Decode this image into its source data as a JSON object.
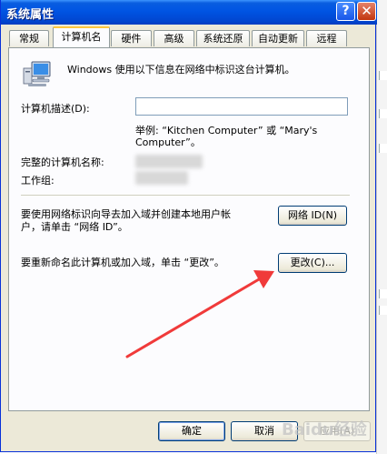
{
  "window": {
    "title": "系统属性"
  },
  "titlebar_buttons": {
    "help": "?",
    "close": "✕"
  },
  "tabs": [
    "常规",
    "计算机名",
    "硬件",
    "高级",
    "系统还原",
    "自动更新",
    "远程"
  ],
  "active_tab": "计算机名",
  "panel": {
    "intro": "Windows 使用以下信息在网络中标识这台计算机。",
    "description_label": "计算机描述(D):",
    "description_value": "",
    "example_line1": "举例: “Kitchen Computer” 或 “Mary's",
    "example_line2": "Computer”。",
    "full_name_label": "完整的计算机名称:",
    "workgroup_label": "工作组:",
    "network_id_text_line1": "要使用网络标识向导去加入域并创建本地用户帐",
    "network_id_text_line2": "户，请单击 “网络 ID”。",
    "network_id_button": "网络 ID(N)",
    "rename_text": "要重新命名此计算机或加入域，单击 “更改”。",
    "change_button": "更改(C)..."
  },
  "footer": {
    "ok": "确定",
    "cancel": "取消",
    "apply": "应用(A)"
  },
  "watermark": "Baidu经验",
  "colors": {
    "titlebar": "#0054e3",
    "arrow": "#f03a3a",
    "tab_highlight": "#ffc73c"
  },
  "icons": [
    "computer-icon",
    "help-icon",
    "close-icon",
    "red-arrow-annotation"
  ]
}
